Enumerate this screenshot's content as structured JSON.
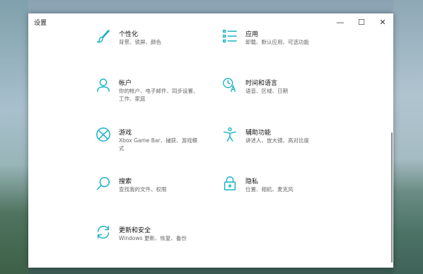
{
  "window": {
    "title": "设置",
    "controls": {
      "minimize": "—",
      "maximize": "☐",
      "close": "✕"
    }
  },
  "items": [
    {
      "name": "个性化",
      "desc": "背景、锁屏、颜色",
      "icon": "brush-icon"
    },
    {
      "name": "应用",
      "desc": "卸载、默认应用、可选功能",
      "icon": "apps-list-icon"
    },
    {
      "name": "帐户",
      "desc": "你的帐户、电子邮件、同步设置、工作、家庭",
      "icon": "person-icon"
    },
    {
      "name": "时间和语言",
      "desc": "语音、区域、日期",
      "icon": "time-language-icon"
    },
    {
      "name": "游戏",
      "desc": "Xbox Game Bar、捕获、游戏模式",
      "icon": "xbox-icon"
    },
    {
      "name": "辅助功能",
      "desc": "讲述人、放大镜、高对比度",
      "icon": "accessibility-icon"
    },
    {
      "name": "搜索",
      "desc": "查找我的文件、权限",
      "icon": "search-icon"
    },
    {
      "name": "隐私",
      "desc": "位置、相机、麦克风",
      "icon": "lock-icon"
    },
    {
      "name": "更新和安全",
      "desc": "Windows 更新、恢复、备份",
      "icon": "refresh-icon"
    }
  ],
  "colors": {
    "accent": "#1db3c4"
  }
}
